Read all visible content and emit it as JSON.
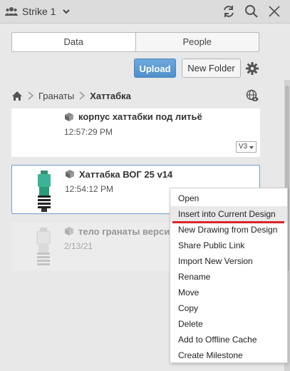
{
  "header": {
    "hub_name": "Strike 1"
  },
  "tabs": [
    {
      "label": "Data",
      "active": true
    },
    {
      "label": "People",
      "active": false
    }
  ],
  "toolbar": {
    "upload_label": "Upload",
    "new_folder_label": "New Folder"
  },
  "breadcrumb": {
    "items": [
      "Гранаты"
    ],
    "current": "Хаттабка"
  },
  "items": [
    {
      "name": "корпус хаттабки под литьё",
      "time": "12:57:29 PM",
      "version": "V3"
    },
    {
      "name": "Хаттабка ВОГ 25 v14",
      "time": "12:54:12 PM"
    },
    {
      "name": "тело гранаты верси",
      "time": "2/13/21"
    }
  ],
  "context_menu": {
    "items": [
      "Open",
      "Insert into Current Design",
      "New Drawing from Design",
      "Share Public Link",
      "Import New Version",
      "Rename",
      "Move",
      "Copy",
      "Delete",
      "Add to Offline Cache",
      "Create Milestone"
    ],
    "highlighted": "Insert into Current Design"
  },
  "colors": {
    "accent": "#5b9bd5",
    "highlight_underline": "#d9262a",
    "selection_border": "#6e9fd3"
  }
}
